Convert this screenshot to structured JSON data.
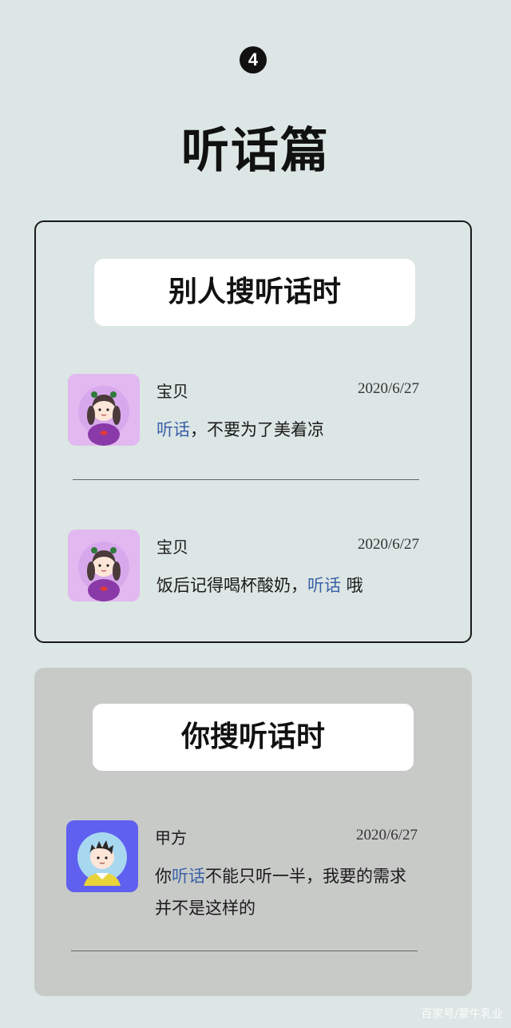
{
  "step_number": "4",
  "page_title": "听话篇",
  "section_others": {
    "heading": "别人搜听话时",
    "messages": [
      {
        "sender": "宝贝",
        "date": "2020/6/27",
        "text_highlight": "听话",
        "text_rest": "，不要为了美着凉",
        "avatar": "girl-avatar-icon"
      },
      {
        "sender": "宝贝",
        "date": "2020/6/27",
        "text_before": "饭后记得喝杯酸奶，",
        "text_highlight": "听话",
        "text_after": " 哦",
        "avatar": "girl-avatar-icon"
      }
    ]
  },
  "section_you": {
    "heading": "你搜听话时",
    "messages": [
      {
        "sender": "甲方",
        "date": "2020/6/27",
        "text_before": "你",
        "text_highlight": "听话",
        "text_after": "不能只听一半，我要的需求并不是这样的",
        "avatar": "boy-avatar-icon"
      }
    ]
  },
  "watermark": "百家号/蒙牛乳业",
  "colors": {
    "background": "#dce6e4",
    "highlight": "#3a60a8",
    "girl_avatar_bg": "#e2b8f0",
    "boy_avatar_bg": "#6060f0",
    "panel_2_bg": "#c8cac8"
  }
}
